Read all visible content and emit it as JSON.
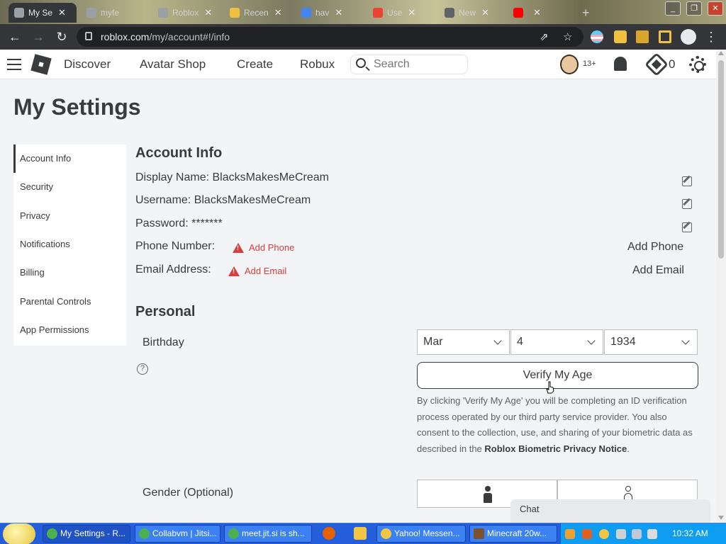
{
  "browser": {
    "tabs": [
      {
        "title": "My Se",
        "active": true
      },
      {
        "title": "myfe",
        "active": false
      },
      {
        "title": "Roblox",
        "active": false
      },
      {
        "title": "Recen",
        "active": false
      },
      {
        "title": "hav",
        "active": false
      },
      {
        "title": "Use",
        "active": false
      },
      {
        "title": "New",
        "active": false
      },
      {
        "title": "",
        "active": false
      }
    ],
    "new_tab": "+",
    "close_glyph": "✕",
    "url_host": "roblox.com",
    "url_path": "/my/account#!/info",
    "window_controls": [
      "_",
      "❐",
      "✕"
    ]
  },
  "header": {
    "nav": [
      "Discover",
      "Avatar Shop",
      "Create",
      "Robux"
    ],
    "search_placeholder": "Search",
    "age_badge": "13+",
    "robux": "0"
  },
  "page": {
    "title": "My Settings"
  },
  "sidebar": {
    "items": [
      {
        "label": "Account Info",
        "active": true
      },
      {
        "label": "Security"
      },
      {
        "label": "Privacy"
      },
      {
        "label": "Notifications"
      },
      {
        "label": "Billing"
      },
      {
        "label": "Parental Controls"
      },
      {
        "label": "App Permissions"
      }
    ]
  },
  "account_info": {
    "title": "Account Info",
    "display_name": "Display Name: BlacksMakesMeCream",
    "username": "Username: BlacksMakesMeCream",
    "password": "Password: *******",
    "phone_label": "Phone Number:",
    "phone_warning": "Add Phone",
    "phone_action": "Add Phone",
    "email_label": "Email Address:",
    "email_warning": "Add Email",
    "email_action": "Add Email"
  },
  "personal": {
    "title": "Personal",
    "birthday_label": "Birthday",
    "help_glyph": "?",
    "month": "Mar",
    "day": "4",
    "year": "1934",
    "verify_button": "Verify My Age",
    "disclaimer_text": "By clicking 'Verify My Age' you will be completing an ID verification process operated by our third party service provider. You also consent to the collection, use, and sharing of your biometric data as described in the ",
    "disclaimer_link": "Roblox Biometric Privacy Notice",
    "disclaimer_end": ".",
    "gender_label": "Gender (Optional)"
  },
  "chat": {
    "label": "Chat"
  },
  "taskbar": {
    "tasks": [
      "My Settings - R...",
      "Collabvm | Jitsi...",
      "meet.jit.si is sh...",
      "",
      "",
      "Yahoo! Messen...",
      "Minecraft 20w..."
    ],
    "clock": "10:32 AM"
  },
  "colors": {
    "page_bg": "#f2f4f5",
    "text": "#393b3d",
    "warning": "#d63f3f",
    "taskbar": "#245edb",
    "tray": "#0f9df1"
  }
}
